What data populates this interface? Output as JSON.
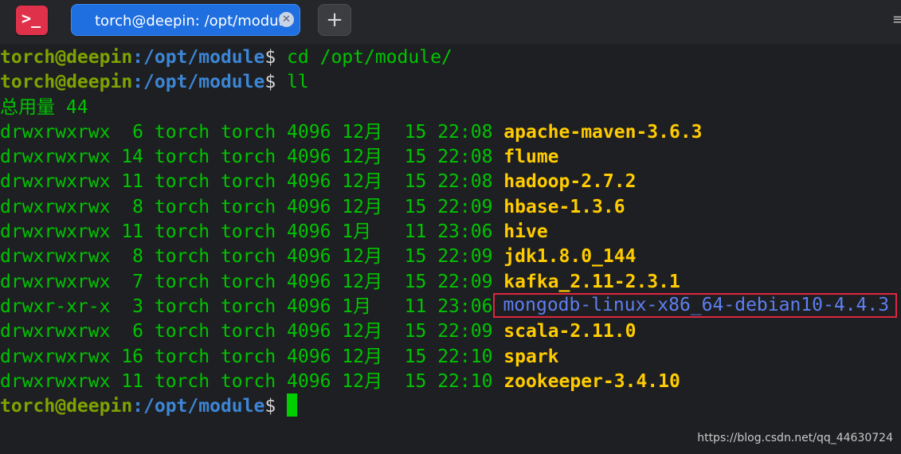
{
  "tab": {
    "title": "torch@deepin: /opt/module",
    "close_glyph": "✕"
  },
  "add_tab_glyph": "+",
  "app_icon_glyph": ">_",
  "prompt": {
    "user": "torch@deepin",
    "path": ":/opt/module",
    "symbol": "$"
  },
  "commands": [
    "cd /opt/module/",
    "ll"
  ],
  "total_line": "总用量 44",
  "listing": [
    {
      "meta": "drwxrwxrwx  6 torch torch 4096 12月  15 22:08 ",
      "name": "apache-maven-3.6.3"
    },
    {
      "meta": "drwxrwxrwx 14 torch torch 4096 12月  15 22:08 ",
      "name": "flume"
    },
    {
      "meta": "drwxrwxrwx 11 torch torch 4096 12月  15 22:08 ",
      "name": "hadoop-2.7.2"
    },
    {
      "meta": "drwxrwxrwx  8 torch torch 4096 12月  15 22:09 ",
      "name": "hbase-1.3.6"
    },
    {
      "meta": "drwxrwxrwx 11 torch torch 4096 1月   11 23:06 ",
      "name": "hive"
    },
    {
      "meta": "drwxrwxrwx  8 torch torch 4096 12月  15 22:09 ",
      "name": "jdk1.8.0_144"
    },
    {
      "meta": "drwxrwxrwx  7 torch torch 4096 12月  15 22:09 ",
      "name": "kafka_2.11-2.3.1"
    },
    {
      "meta": "drwxr-xr-x  3 torch torch 4096 1月   11 23:06",
      "name": "mongodb-linux-x86_64-debian10-4.4.3"
    },
    {
      "meta": "drwxrwxrwx  6 torch torch 4096 12月  15 22:09 ",
      "name": "scala-2.11.0"
    },
    {
      "meta": "drwxrwxrwx 16 torch torch 4096 12月  15 22:10 ",
      "name": "spark"
    },
    {
      "meta": "drwxrwxrwx 11 torch torch 4096 12月  15 22:10 ",
      "name": "zookeeper-3.4.10"
    }
  ],
  "watermark": "https://blog.csdn.net/qq_44630724",
  "colors": {
    "background": "#1e1f22",
    "tab_accent": "#1f6fe0",
    "highlight_box": "#e0253f",
    "directory": "#ffcc00",
    "listing_text": "#00c400"
  }
}
